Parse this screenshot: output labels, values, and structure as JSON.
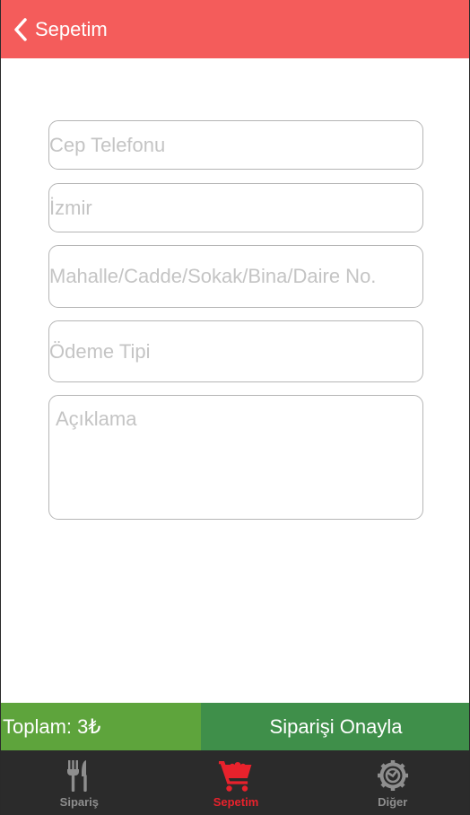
{
  "navbar": {
    "title": "Sepetim",
    "back_icon": "chevron-left-icon",
    "color": "#f45c5b"
  },
  "form": {
    "phone_placeholder": "Cep Telefonu",
    "city_placeholder": "İzmir",
    "address_placeholder": "Mahalle/Cadde/Sokak/Bina/Daire No.",
    "payment_placeholder": "Ödeme Tipi",
    "note_placeholder": "Açıklama"
  },
  "footer": {
    "total_text": "Toplam: 3₺",
    "confirm_label": "Siparişi Onayla",
    "total_color": "#5ea43c",
    "confirm_color": "#3f8f4a"
  },
  "tabbar": {
    "tabs": [
      {
        "label": "Sipariş",
        "icon": "fork-knife-icon",
        "active": false
      },
      {
        "label": "Sepetim",
        "icon": "cart-icon",
        "active": true
      },
      {
        "label": "Diğer",
        "icon": "gear-icon",
        "active": false
      }
    ],
    "active_color": "#e8222c",
    "inactive_color": "#8e8e8e"
  }
}
